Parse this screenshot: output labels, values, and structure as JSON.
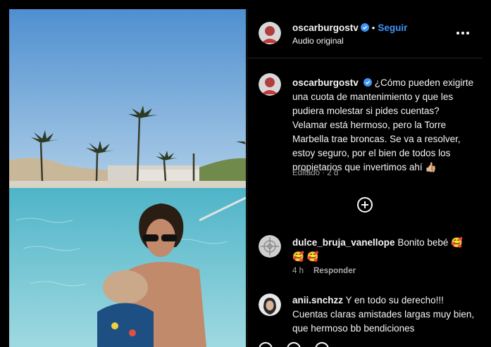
{
  "post": {
    "author": "oscarburgostv",
    "follow_label": "Seguir",
    "separator": "•",
    "audio_label": "Audio original"
  },
  "caption": {
    "author": "oscarburgostv",
    "text": "¿Cómo pueden exigirte una cuota de mantenimiento y que les pudiera molestar si pides cuentas? Velamar está hermoso, pero la Torre Marbella trae broncas. Se va a resolver, estoy seguro, por el bien de todos los propietarios que invertimos ahí 👍🏼",
    "meta": "Editado · 2 d"
  },
  "comments": [
    {
      "author": "dulce_bruja_vanellope",
      "text": "Bonito bebé 🥰 🥰 🥰",
      "time": "4 h",
      "reply_label": "Responder"
    },
    {
      "author": "anii.snchzz",
      "text": "Y en todo su derecho!!! Cuentas claras amistades largas muy bien, que hermoso bb bendiciones"
    }
  ],
  "colors": {
    "background": "#000000",
    "accent_blue": "#3f95f6",
    "muted_text": "#a8a8a8",
    "divider": "#262626"
  },
  "icons": {
    "verified": "verified-badge-icon",
    "more": "more-options-icon",
    "load_more": "plus-circle-icon"
  }
}
